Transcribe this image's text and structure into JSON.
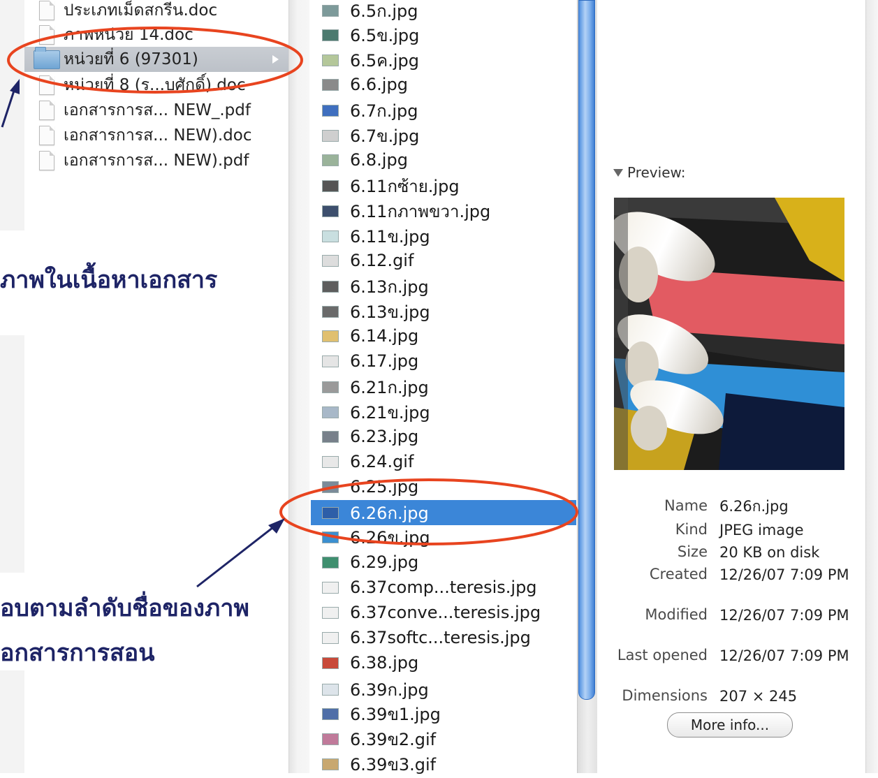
{
  "column1": {
    "items": [
      {
        "label": "ประเภทเม็ดสกรีน.doc",
        "icon": "document-icon"
      },
      {
        "label": "ภาพหน่วย 14.doc",
        "icon": "document-icon"
      },
      {
        "label": "หน่วยที่ 6 (97301)",
        "icon": "folder-icon",
        "selected": true
      },
      {
        "label": "หน่วยที่ 8 (ร...บศักดิ์).doc",
        "icon": "document-icon"
      },
      {
        "label": "เอกสารการส... NEW_.pdf",
        "icon": "pdf-icon"
      },
      {
        "label": "เอกสารการส... NEW).doc",
        "icon": "document-icon"
      },
      {
        "label": "เอกสารการส... NEW).pdf",
        "icon": "pdf-icon"
      }
    ]
  },
  "column2": {
    "items": [
      {
        "label": "6.5ก.jpg",
        "thumb": "#7d9a9a"
      },
      {
        "label": "6.5ข.jpg",
        "thumb": "#4c7a6f"
      },
      {
        "label": "6.5ค.jpg",
        "thumb": "#b4c79a"
      },
      {
        "label": "6.6.jpg",
        "thumb": "#8a8a8a"
      },
      {
        "label": "6.7ก.jpg",
        "thumb": "#3f6fbf"
      },
      {
        "label": "6.7ข.jpg",
        "thumb": "#cfcfcf"
      },
      {
        "label": "6.8.jpg",
        "thumb": "#9ab39a"
      },
      {
        "label": "6.11กซ้าย.jpg",
        "thumb": "#555555"
      },
      {
        "label": "6.11กภาพขวา.jpg",
        "thumb": "#3d4f6d"
      },
      {
        "label": "6.11ข.jpg",
        "thumb": "#c9dfe0"
      },
      {
        "label": "6.12.gif",
        "thumb": "#dddddd"
      },
      {
        "label": "6.13ก.jpg",
        "thumb": "#5d5d5d"
      },
      {
        "label": "6.13ข.jpg",
        "thumb": "#6a6a6a"
      },
      {
        "label": "6.14.jpg",
        "thumb": "#e0c070"
      },
      {
        "label": "6.17.jpg",
        "thumb": "#e5e5e5"
      },
      {
        "label": "6.21ก.jpg",
        "thumb": "#9a9a9a"
      },
      {
        "label": "6.21ข.jpg",
        "thumb": "#a8b8c8"
      },
      {
        "label": "6.23.jpg",
        "thumb": "#77808a"
      },
      {
        "label": "6.24.gif",
        "thumb": "#e8e8e8"
      },
      {
        "label": "6.25.jpg",
        "thumb": "#7b8b99"
      },
      {
        "label": "6.26ก.jpg",
        "thumb": "#2d5ea8",
        "selected": true
      },
      {
        "label": "6.26ข.jpg",
        "thumb": "#3b8fd0"
      },
      {
        "label": "6.29.jpg",
        "thumb": "#3f8f6f"
      },
      {
        "label": "6.37comp...teresis.jpg",
        "thumb": "#f0f0f0"
      },
      {
        "label": "6.37conve...teresis.jpg",
        "thumb": "#f0f0f0"
      },
      {
        "label": "6.37softc...teresis.jpg",
        "thumb": "#f0f0f0"
      },
      {
        "label": "6.38.jpg",
        "thumb": "#c84a3a"
      },
      {
        "label": "6.39ก.jpg",
        "thumb": "#dde4ea"
      },
      {
        "label": "6.39ข1.jpg",
        "thumb": "#4f6fa8"
      },
      {
        "label": "6.39ข2.gif",
        "thumb": "#c07a9a"
      },
      {
        "label": "6.39ข3.gif",
        "thumb": "#c8a870"
      }
    ]
  },
  "preview": {
    "header": "Preview:",
    "info": [
      {
        "key": "Name",
        "value": "6.26ก.jpg"
      },
      {
        "key": "Kind",
        "value": "JPEG image"
      },
      {
        "key": "Size",
        "value": "20 KB on disk"
      },
      {
        "key": "Created",
        "value": "12/26/07 7:09 PM"
      },
      {
        "key": "Modified",
        "value": "12/26/07 7:09 PM"
      },
      {
        "key": "Last opened",
        "value": "12/26/07 7:09 PM"
      },
      {
        "key": "Dimensions",
        "value": "207 × 245"
      }
    ],
    "more_info_label": "More info..."
  },
  "annotations": {
    "caption1": "ภาพในเนื้อหาเอกสาร",
    "caption2_line1": "อบตามลำดับชื่อของภาพ",
    "caption2_line2": "อกสารการสอน"
  },
  "colors": {
    "annotation_ellipse": "#e8441f",
    "annotation_arrow": "#1e2466",
    "selection_blue": "#3b86d8"
  }
}
